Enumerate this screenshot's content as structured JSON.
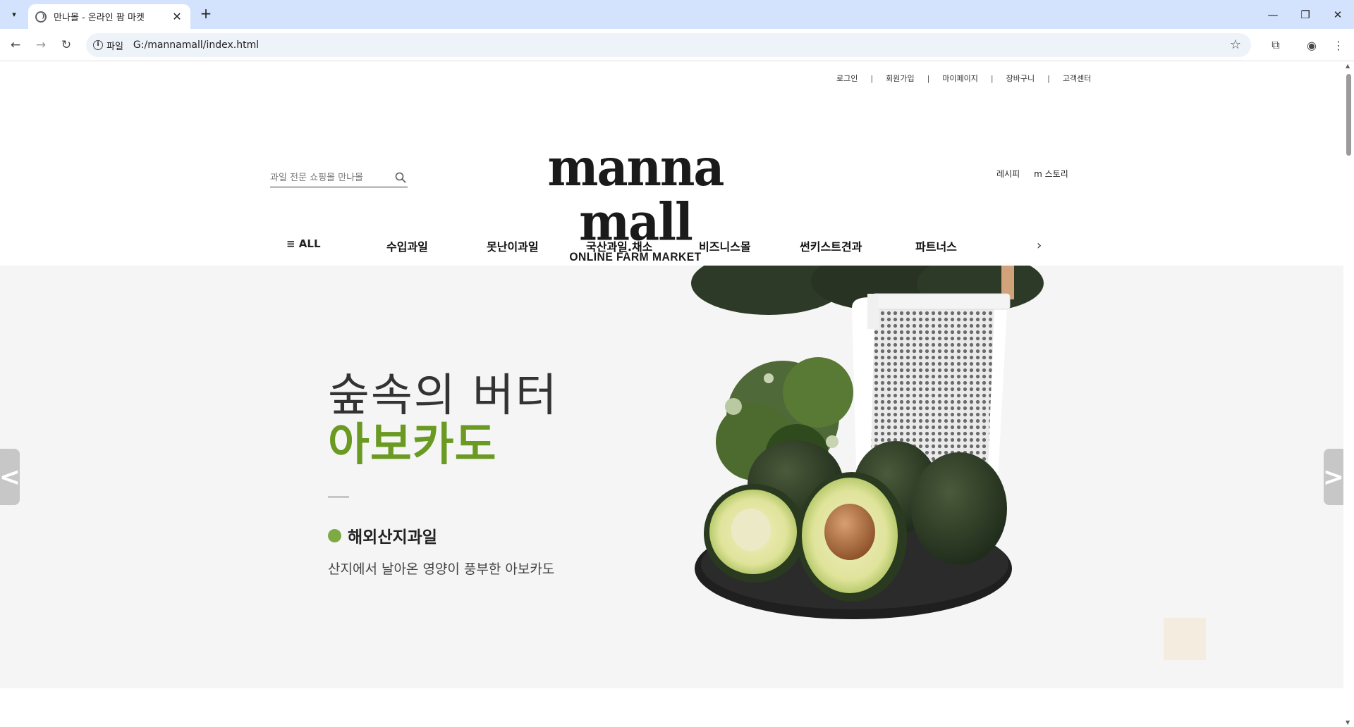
{
  "browser": {
    "tab_title": "만나몰 - 온라인 팜 마켓",
    "url_chip": "파일",
    "url": "G:/mannamall/index.html"
  },
  "utility_nav": {
    "login": "로그인",
    "signup": "회원가입",
    "mypage": "마이페이지",
    "cart": "장바구니",
    "support": "고객센터",
    "separator": "|"
  },
  "search": {
    "placeholder": "과일 전문 쇼핑몰 만나몰"
  },
  "logo": {
    "main": "manna mall",
    "sub": "ONLINE FARM MARKET"
  },
  "side_links": {
    "recipe": "레시피",
    "story": "m 스토리"
  },
  "gnb": {
    "all": "≡ ALL",
    "items": [
      "수입과일",
      "못난이과일",
      "국산과일.채소",
      "비즈니스몰",
      "썬키스트견과",
      "파트너스"
    ]
  },
  "hero": {
    "line1": "숲속의 버터",
    "line2": "아보카도",
    "category": "해외산지과일",
    "description": "산지에서 날아온 영양이 풍부한 아보카도",
    "prev": "<",
    "next": ">"
  },
  "colors": {
    "accent_green": "#6a9a22",
    "dot_green": "#7daa45",
    "chrome_tabstrip": "#d3e3fd"
  }
}
